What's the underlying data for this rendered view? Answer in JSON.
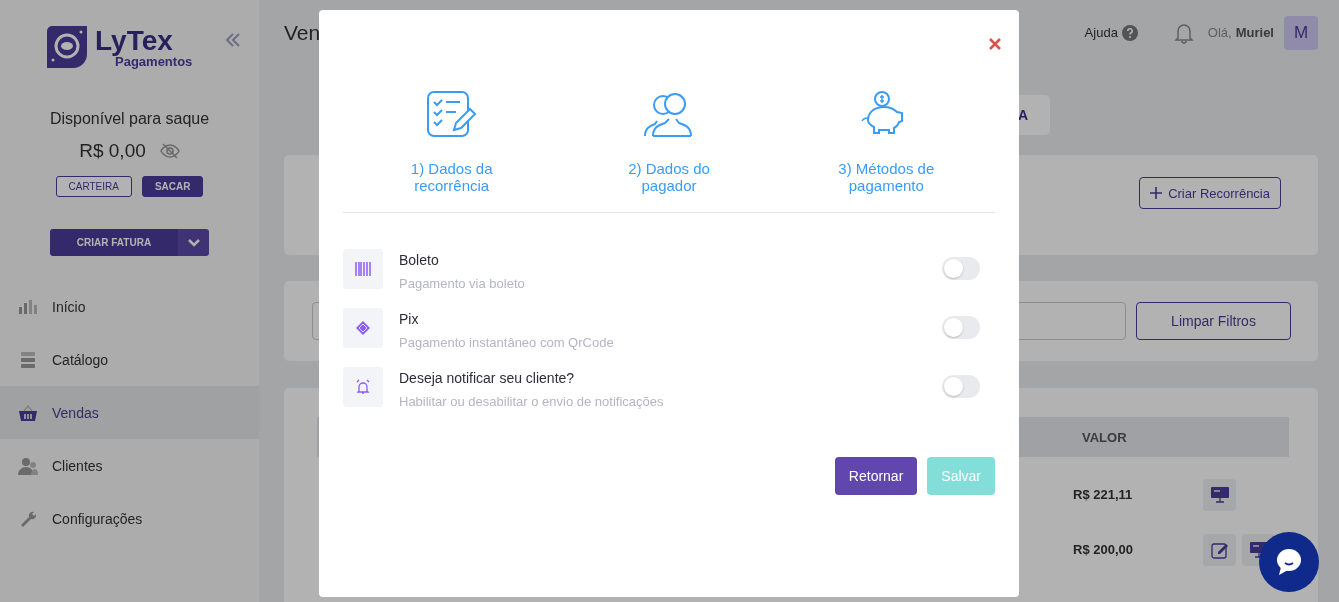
{
  "sidebar": {
    "logo": {
      "name": "LyTex",
      "tagline": "Pagamentos"
    },
    "balance": {
      "label": "Disponível para saque",
      "amount": "R$ 0,00"
    },
    "wallet_buttons": [
      {
        "label": "CARTEIRA",
        "kind": "outline"
      },
      {
        "label": "SACAR",
        "kind": "solid"
      }
    ],
    "create_invoice": "CRIAR FATURA",
    "nav": [
      {
        "label": "Início",
        "selected": false
      },
      {
        "label": "Catálogo",
        "selected": false
      },
      {
        "label": "Vendas",
        "selected": true
      },
      {
        "label": "Clientes",
        "selected": false
      },
      {
        "label": "Configurações",
        "selected": false
      }
    ]
  },
  "header": {
    "title": "Ven",
    "help": "Ajuda",
    "greeting": "Olá,",
    "user": "Muriel",
    "avatar": "M"
  },
  "tab_partial": "A",
  "create_recurrence": "Criar Recorrência",
  "clear_filters": "Limpar Filtros",
  "table": {
    "columns": [
      "VALOR"
    ],
    "rows": [
      {
        "valor": "R$ 221,11"
      },
      {
        "valor": "R$ 200,00"
      }
    ]
  },
  "modal": {
    "steps": [
      {
        "label": "1) Dados da recorrência"
      },
      {
        "label": "2) Dados do pagador"
      },
      {
        "label": "3) Métodos de pagamento"
      }
    ],
    "options": [
      {
        "title": "Boleto",
        "subtitle": "Pagamento via boleto",
        "on": false
      },
      {
        "title": "Pix",
        "subtitle": "Pagamento instantâneo com QrCode",
        "on": false
      },
      {
        "title": "Deseja notificar seu cliente?",
        "subtitle": "Habilitar ou desabilitar o envio de notificações",
        "on": false
      }
    ],
    "buttons": [
      {
        "label": "Retornar",
        "kind": "primary",
        "disabled": false
      },
      {
        "label": "Salvar",
        "kind": "save",
        "disabled": true
      }
    ]
  }
}
